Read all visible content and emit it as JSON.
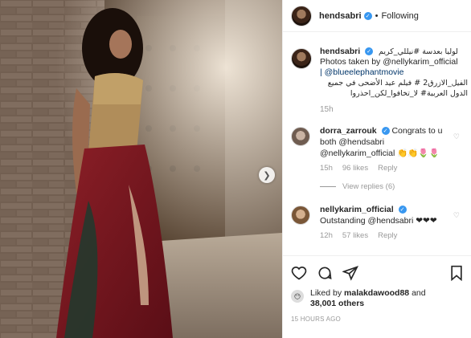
{
  "header": {
    "username": "hendsabri",
    "verified_icon": "verified-badge-icon",
    "separator": "•",
    "follow_label": "Following"
  },
  "caption": {
    "username": "hendsabri",
    "line_arabic_1": "لوليا بعدسة #نيللي_كريم",
    "line_2": "Photos taken by @nellykarim_official",
    "line_3": "| @blueelephantmovie",
    "line_arabic_2": "الفيل_الازرق2 # فيلم عيد الأضحى في جميع",
    "line_arabic_3": "الدول العربية# لا_تخافوا_لكن_احذروا",
    "time": "15h"
  },
  "comments": [
    {
      "username": "dorra_zarrouk",
      "text_1": "Congrats to u",
      "text_2": "both @hendsabri",
      "text_3": "@nellykarim_official 👏👏🌷🌷",
      "time": "15h",
      "likes": "96 likes",
      "reply": "Reply",
      "view_replies": "View replies (6)"
    },
    {
      "username": "nellykarim_official",
      "text_1": "Outstanding @hendsabri ❤❤❤",
      "time": "12h",
      "likes": "57 likes",
      "reply": "Reply"
    }
  ],
  "actions": {
    "liked_by_prefix": "Liked by ",
    "liked_by_user": "malakdawood88",
    "liked_by_suffix": " and",
    "others": "38,001 others",
    "timestamp": "15 HOURS AGO"
  },
  "icons": {
    "like": "heart-icon",
    "comment": "comment-icon",
    "share": "share-icon",
    "save": "bookmark-icon",
    "next": "chevron-right-icon"
  },
  "colors": {
    "verified": "#3897f0",
    "link": "#003569",
    "muted": "#999999",
    "text": "#262626"
  }
}
